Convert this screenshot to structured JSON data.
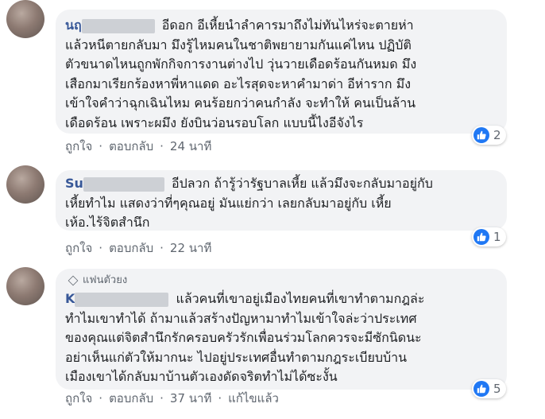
{
  "comments": [
    {
      "author": "นฤ",
      "text_lines": [
        "อีดอก อีเหี้ยนำลำคารมาถึงไม่ทันไหร่จะตายห่า",
        "แล้วหนีตายกลับมา มึงรู้ไหมคนในชาติพยายามกันแค่ไหน ปฏิบัติ",
        "ตัวขนาดไหนถูกพักกิจการงานต่างไป วุ่นวายเดือดร้อนกันหมด มึง",
        "เสือกมาเรียกร้องหาพี่หาแดด อะไรสุดจะหาคำมาด่า อีห่าราก มึง",
        "เข้าใจคำว่าฉุกเฉินไหม คนร้อยกว่าคนกำลัง จะทำให้ คนเป็นล้าน",
        "เดือดร้อน เพราะผมึง ยังบินว่อนรอบโลก แบบนี้ไงอีจังไร"
      ],
      "like_label": "ถูกใจ",
      "reply_label": "ตอบกลับ",
      "time": "24 นาที",
      "reaction_count": "2"
    },
    {
      "author": "Su",
      "text_lines": [
        "อีปลวก ถ้ารู้ว่ารัฐบาลเหี้ย แล้วมึงจะกลับมาอยู่กับ",
        "เหี้ยทำไม แสดงว่าที่ๆคุณอยู่ มันแย่กว่า เลยกลับมาอยู่กับ เหี้ย",
        "เห้อ.ไร้จิตสำนึก"
      ],
      "like_label": "ถูกใจ",
      "reply_label": "ตอบกลับ",
      "time": "22 นาที",
      "reaction_count": "1"
    },
    {
      "badge": "แฟนตัวยง",
      "author": "K",
      "text_lines": [
        "แล้วคนที่เขาอยู่เมืองไทยคนที่เขาทำตามกฎล่ะ",
        "ทำไมเขาทำได้ ถ้ามาแล้วสร้างปัญหามาทำไมเข้าใจล่ะว่าประเทศ",
        "ของคุณแต่จิตสำนึกรักครอบครัวรักเพื่อนร่วมโลกควรจะมีซักนิดนะ",
        "อย่าเห็นแก่ตัวให้มากนะ ไปอยู่ประเทศอื่นทำตามกฎระเบียบบ้าน",
        "เมืองเขาได้กลับมาบ้านตัวเองดัดจริตทำไม่ได้ซะงั้น"
      ],
      "like_label": "ถูกใจ",
      "reply_label": "ตอบกลับ",
      "time": "37 นาที",
      "edited_label": "แก้ไขแล้ว",
      "reaction_count": "5"
    }
  ],
  "colors": {
    "author": "#385898",
    "bubble": "#f2f3f5",
    "like": "#2078f4",
    "meta": "#606770"
  },
  "icons": {
    "reaction": "thumbs-up-icon",
    "badge": "diamond-icon"
  }
}
